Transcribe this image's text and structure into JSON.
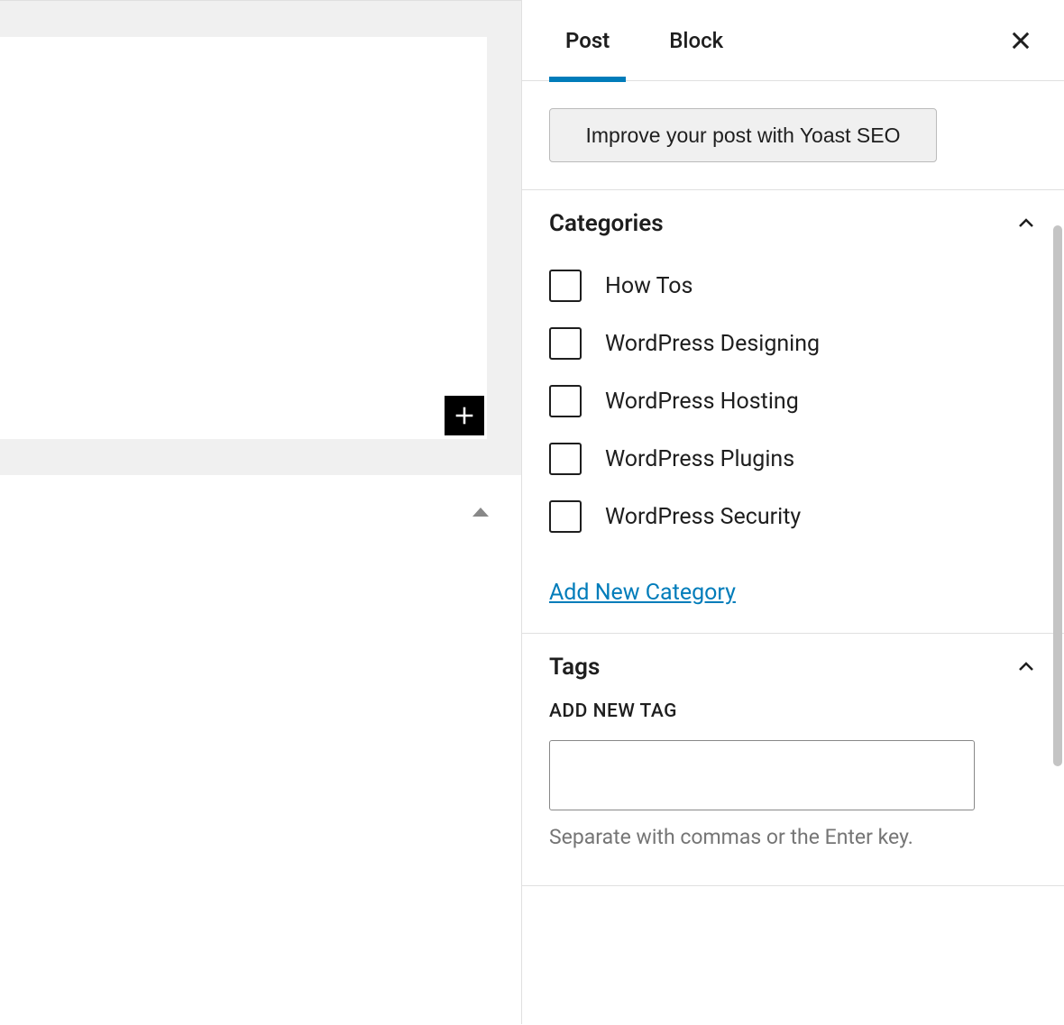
{
  "tabs": {
    "post": "Post",
    "block": "Block"
  },
  "yoast": {
    "button_label": "Improve your post with Yoast SEO"
  },
  "categories": {
    "title": "Categories",
    "items": [
      {
        "label": "How Tos",
        "checked": false
      },
      {
        "label": "WordPress Designing",
        "checked": false
      },
      {
        "label": "WordPress Hosting",
        "checked": false
      },
      {
        "label": "WordPress Plugins",
        "checked": false
      },
      {
        "label": "WordPress Security",
        "checked": false
      }
    ],
    "add_new_link": "Add New Category"
  },
  "tags": {
    "title": "Tags",
    "add_label": "ADD NEW TAG",
    "input_value": "",
    "hint": "Separate with commas or the Enter key."
  }
}
